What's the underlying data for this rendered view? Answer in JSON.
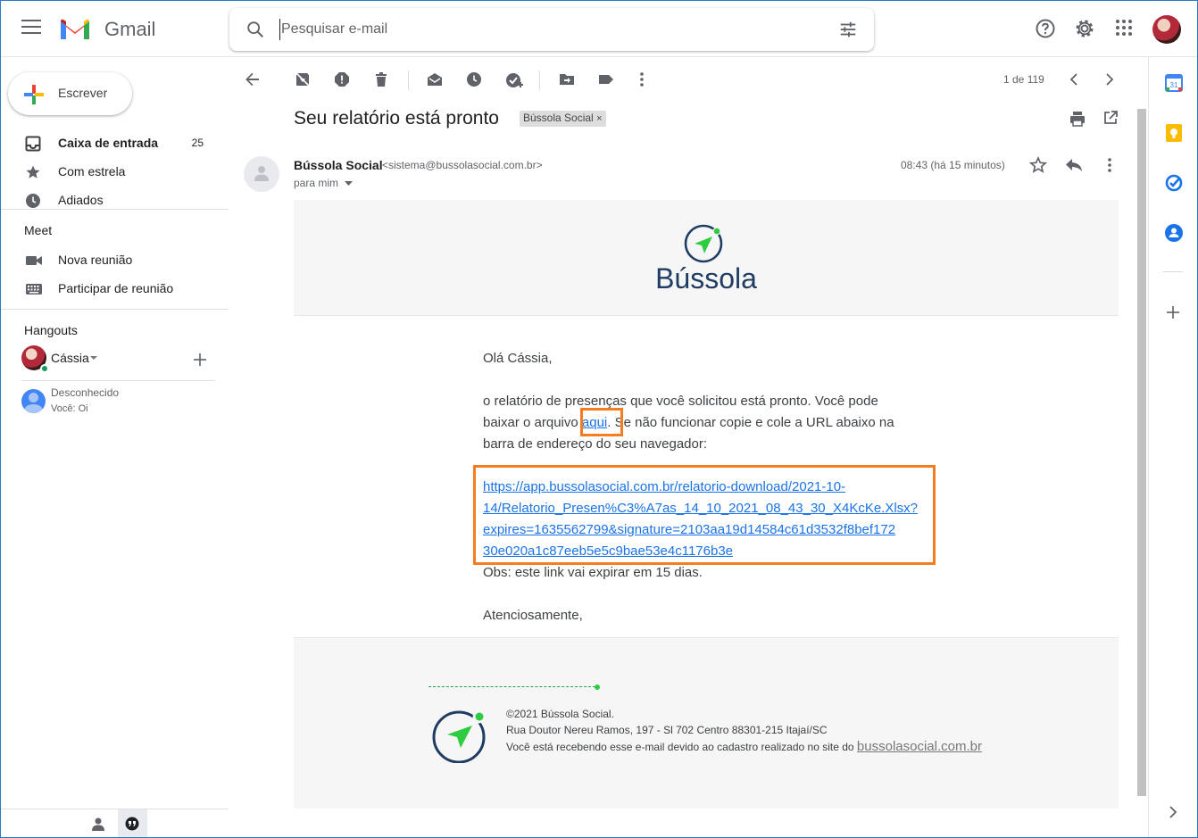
{
  "header": {
    "app_name": "Gmail",
    "search_placeholder": "Pesquisar e-mail"
  },
  "sidebar": {
    "compose_label": "Escrever",
    "items": [
      {
        "label": "Caixa de entrada",
        "count": "25"
      },
      {
        "label": "Com estrela"
      },
      {
        "label": "Adiados"
      }
    ],
    "meet": {
      "title": "Meet",
      "items": [
        {
          "label": "Nova reunião"
        },
        {
          "label": "Participar de reunião"
        }
      ]
    },
    "hangouts": {
      "title": "Hangouts",
      "user": "Cássia",
      "contacts": [
        {
          "name": "Desconhecido",
          "snippet": "Você: Oi"
        }
      ]
    }
  },
  "toolbar": {
    "pager": "1 de 119"
  },
  "message": {
    "subject": "Seu relatório está pronto",
    "label": "Bússola Social",
    "sender_name": "Bússola Social",
    "sender_email": "<sistema@bussolasocial.com.br>",
    "to": "para mim",
    "time": "08:43 (há 15 minutos)"
  },
  "email": {
    "brand": "Bússola",
    "greeting": "Olá Cássia,",
    "para_line1": "o relatório de presenças que você solicitou está pronto. Você pode",
    "para_line2_pre": "baixar o arquivo ",
    "link_text": "aqui",
    "para_line2_post": ". Se não funcionar copie e cole a URL abaixo na",
    "para_line3": "barra de endereço do seu navegador:",
    "url_lines": [
      "https://app.bussolasocial.com.br/relatorio-download/2021-10-",
      "14/Relatorio_Presen%C3%A7as_14_10_2021_08_43_30_X4KcKe.Xlsx?",
      "expires=1635562799&signature=2103aa19d14584c61d3532f8bef172",
      "30e020a1c87eeb5e5c9bae53e4c1176b3e"
    ],
    "obs": "Obs: este link vai expirar em 15 dias.",
    "closing": "Atenciosamente,",
    "footer": {
      "copyright": "©2021 Bússola Social.",
      "address": "Rua Doutor Nereu Ramos, 197 - Sl 702 Centro 88301-215 Itajaí/SC",
      "notice": "Você está recebendo esse e-mail devido ao cadastro realizado no site do ",
      "site": "bussolasocial.com.br"
    }
  },
  "colors": {
    "highlight": "#f57c1f",
    "brand_navy": "#1f3c63",
    "brand_green": "#2ecc40",
    "link": "#1a73e8"
  }
}
